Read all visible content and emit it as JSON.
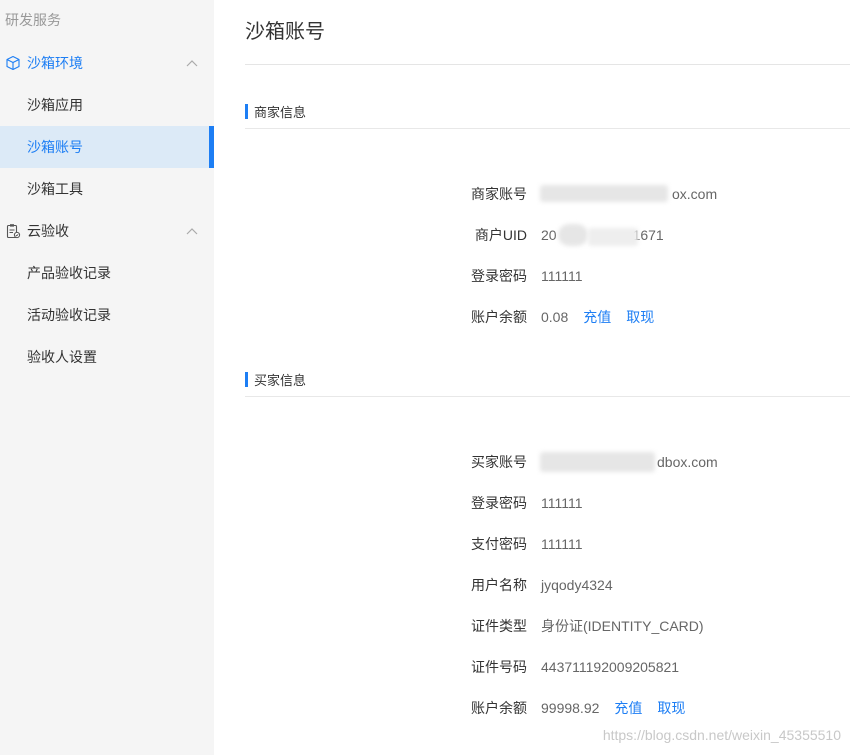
{
  "sidebar": {
    "section_label": "研发服务",
    "group_sandbox": "沙箱环境",
    "item_sandbox_app": "沙箱应用",
    "item_sandbox_account": "沙箱账号",
    "item_sandbox_tools": "沙箱工具",
    "group_cloud": "云验收",
    "item_product_acceptance": "产品验收记录",
    "item_activity_acceptance": "活动验收记录",
    "item_acceptor_settings": "验收人设置"
  },
  "main": {
    "title": "沙箱账号",
    "merchant": {
      "heading": "商家信息",
      "account_label": "商家账号",
      "account_value": "ox.com",
      "uid_label": "商户UID",
      "uid_prefix": "20",
      "uid_suffix": "1671",
      "password_label": "登录密码",
      "password_value": "111111",
      "balance_label": "账户余额",
      "balance_value": "0.08",
      "recharge": "充值",
      "withdraw": "取现"
    },
    "buyer": {
      "heading": "买家信息",
      "account_label": "买家账号",
      "account_value": "dbox.com",
      "password_label": "登录密码",
      "password_value": "111111",
      "paypass_label": "支付密码",
      "paypass_value": "111111",
      "username_label": "用户名称",
      "username_value": "jyqody4324",
      "idtype_label": "证件类型",
      "idtype_value": "身份证(IDENTITY_CARD)",
      "idnum_label": "证件号码",
      "idnum_value": "443711192009205821",
      "balance_label": "账户余额",
      "balance_value": "99998.92",
      "recharge": "充值",
      "withdraw": "取现"
    }
  },
  "watermark": "https://blog.csdn.net/weixin_45355510",
  "colors": {
    "accent": "#1d7ef4",
    "sidebar_bg": "#f5f5f5",
    "selected_bg": "#dceaf7"
  }
}
